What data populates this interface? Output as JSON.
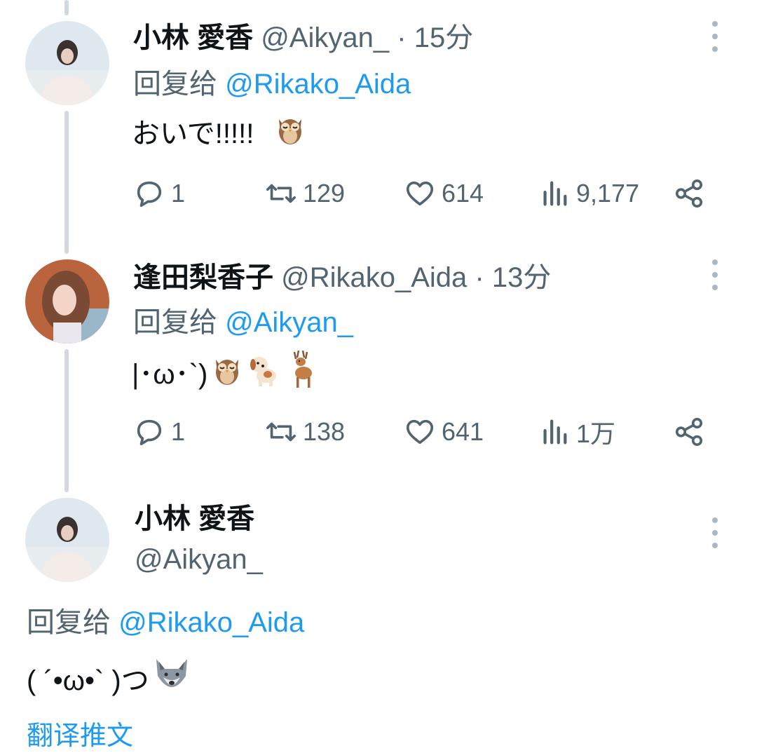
{
  "tweets": [
    {
      "name": "小林 愛香",
      "handle": "@Aikyan_",
      "dot": "·",
      "time": "15分",
      "reply_prefix": "回复给",
      "reply_to": "@Rikako_Aida",
      "text": "おいで!!!!!",
      "emojis": [
        "owl"
      ],
      "actions": {
        "replies": "1",
        "retweets": "129",
        "likes": "614",
        "views": "9,177"
      }
    },
    {
      "name": "逢田梨香子",
      "handle": "@Rikako_Aida",
      "dot": "·",
      "time": "13分",
      "reply_prefix": "回复给",
      "reply_to": "@Aikyan_",
      "text": "|･ω･`)",
      "emojis": [
        "owl",
        "dog",
        "deer"
      ],
      "actions": {
        "replies": "1",
        "retweets": "138",
        "likes": "641",
        "views": "1万"
      }
    }
  ],
  "main_tweet": {
    "name": "小林 愛香",
    "handle": "@Aikyan_",
    "reply_prefix": "回复给",
    "reply_to": "@Rikako_Aida",
    "text": "( ´•ω•` )つ",
    "emojis": [
      "wolf"
    ],
    "translate_label": "翻译推文"
  },
  "colors": {
    "accent": "#1d9bf0",
    "secondary_text": "#536471",
    "thread_line": "#cfd9de"
  },
  "icons": [
    "reply-icon",
    "retweet-icon",
    "like-icon",
    "views-icon",
    "share-icon",
    "more-icon"
  ]
}
